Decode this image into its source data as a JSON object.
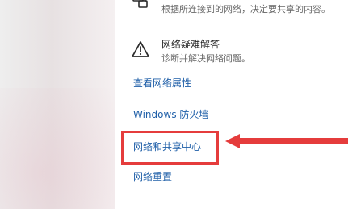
{
  "top_partial": {
    "description": "根据所连接到的网络，决定要共享的内容。"
  },
  "troubleshooter": {
    "title": "网络疑难解答",
    "subtitle": "诊断并解决网络问题。"
  },
  "links": {
    "view_properties": "查看网络属性",
    "windows_firewall": "Windows 防火墙",
    "network_sharing_center": "网络和共享中心",
    "network_reset": "网络重置"
  },
  "colors": {
    "link": "#1f5fa8",
    "highlight_red": "#e53c3c"
  },
  "icons": {
    "top": "share-icon",
    "troubleshooter": "warning-triangle-icon",
    "arrow": "red-left-arrow-icon"
  }
}
